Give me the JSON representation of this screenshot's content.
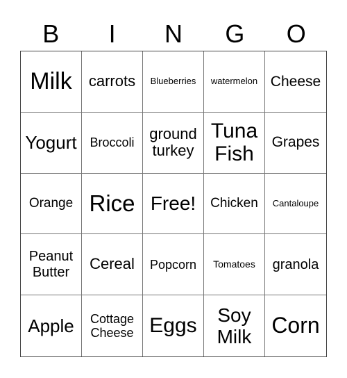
{
  "header": {
    "letters": [
      "B",
      "I",
      "N",
      "G",
      "O"
    ]
  },
  "board": {
    "rows": [
      [
        "Milk",
        "carrots",
        "Blueberries",
        "watermelon",
        "Cheese"
      ],
      [
        "Yogurt",
        "Broccoli",
        "ground turkey",
        "Tuna Fish",
        "Grapes"
      ],
      [
        "Orange",
        "Rice",
        "Free!",
        "Chicken",
        "Cantaloupe"
      ],
      [
        "Peanut Butter",
        "Cereal",
        "Popcorn",
        "Tomatoes",
        "granola"
      ],
      [
        "Apple",
        "Cottage Cheese",
        "Eggs",
        "Soy Milk",
        "Corn"
      ]
    ],
    "free_space": "Free!"
  }
}
